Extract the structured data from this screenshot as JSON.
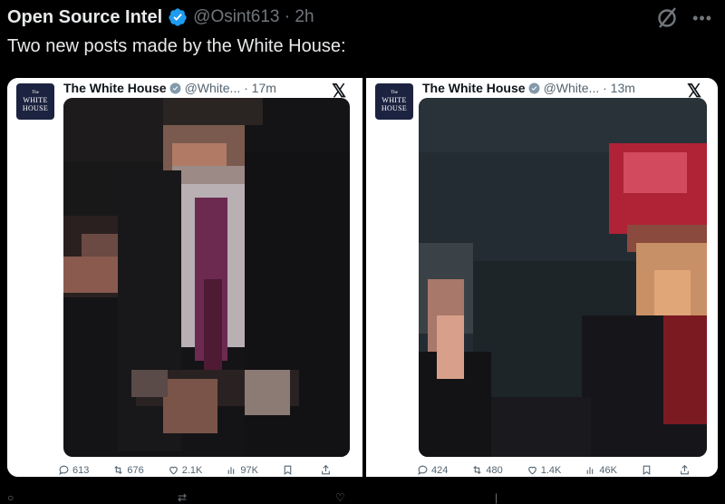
{
  "post": {
    "author_name": "Open Source Intel",
    "handle": "@Osint613 · 2h",
    "text": "Two new posts made by the White House:"
  },
  "embeds": [
    {
      "avatar_small": "The",
      "avatar_line1": "WHITE",
      "avatar_line2": "HOUSE",
      "name": "The White House",
      "handle": "@White... · 17m",
      "x_logo": "𝕏",
      "stats": {
        "replies": "613",
        "reposts": "676",
        "likes": "2.1K",
        "views": "97K"
      }
    },
    {
      "avatar_small": "The",
      "avatar_line1": "WHITE",
      "avatar_line2": "HOUSE",
      "name": "The White House",
      "handle": "@White... · 13m",
      "x_logo": "𝕏",
      "stats": {
        "replies": "424",
        "reposts": "480",
        "likes": "1.4K",
        "views": "46K"
      }
    }
  ],
  "colors": {
    "background": "#000000",
    "verified_blue": "#1d9bf0",
    "muted": "#71767b"
  },
  "icons": [
    "verified-badge-icon",
    "grok-icon",
    "more-icon",
    "reply-icon",
    "repost-icon",
    "like-icon",
    "views-icon",
    "bookmark-icon",
    "share-icon",
    "x-logo-icon"
  ]
}
